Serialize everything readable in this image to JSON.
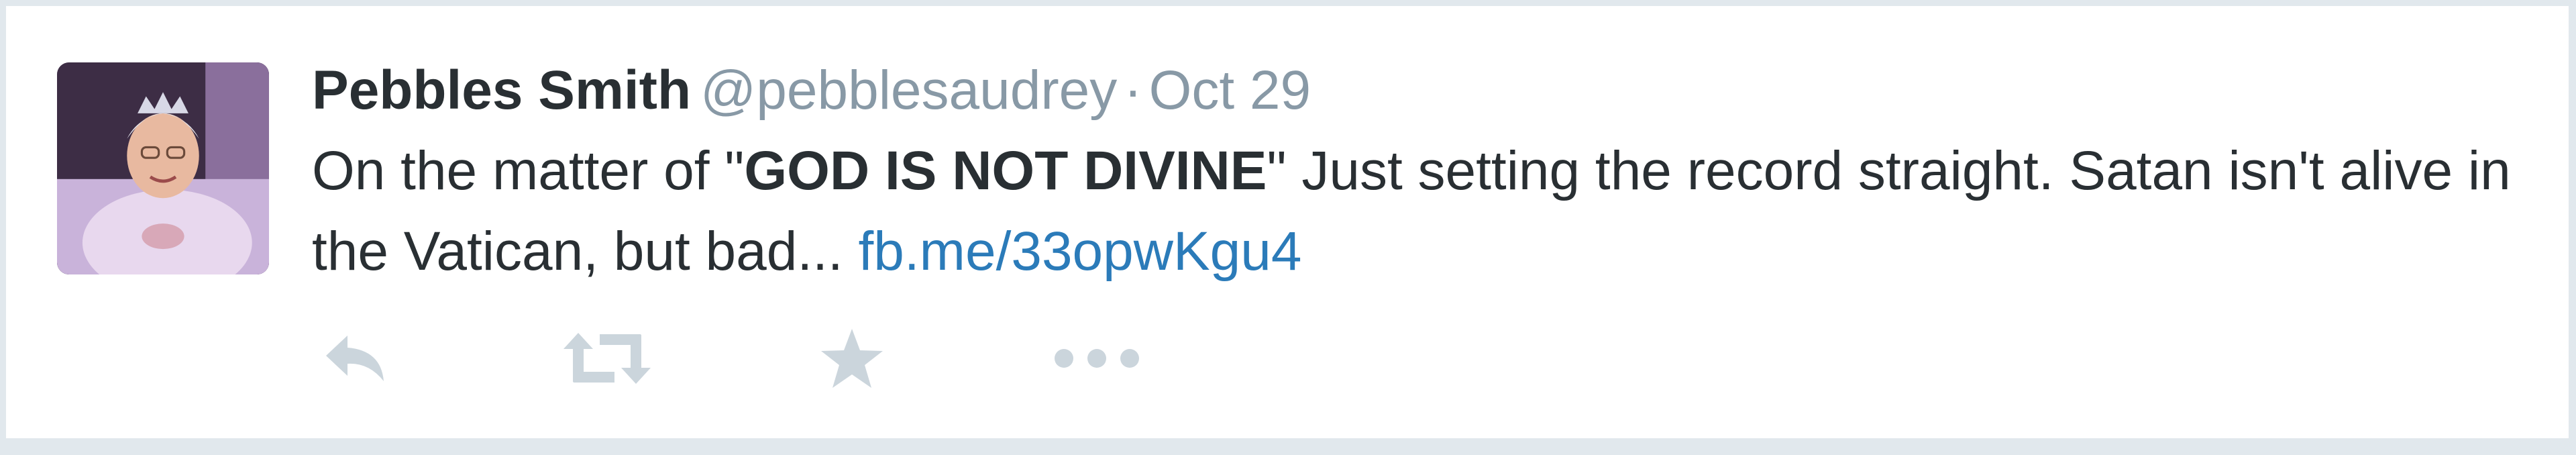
{
  "tweet": {
    "author": {
      "fullname": "Pebbles Smith",
      "username": "@pebblesaudrey"
    },
    "separator": "·",
    "timestamp": "Oct 29",
    "text": {
      "prefix": "On the matter of \"",
      "bold": "GOD IS NOT DIVINE",
      "middle": "\" Just setting the record straight. Satan isn't alive in the Vatican, but bad... ",
      "link": "fb.me/33opwKgu4"
    },
    "actions": [
      {
        "name": "reply",
        "icon": "reply-icon"
      },
      {
        "name": "retweet",
        "icon": "retweet-icon"
      },
      {
        "name": "favorite",
        "icon": "star-icon"
      },
      {
        "name": "more",
        "icon": "ellipsis-icon"
      }
    ]
  },
  "colors": {
    "text": "#292f33",
    "muted": "#8899a6",
    "link": "#2b7bb9",
    "action_icon": "#cbd5dc",
    "border": "#e1e8ed"
  }
}
